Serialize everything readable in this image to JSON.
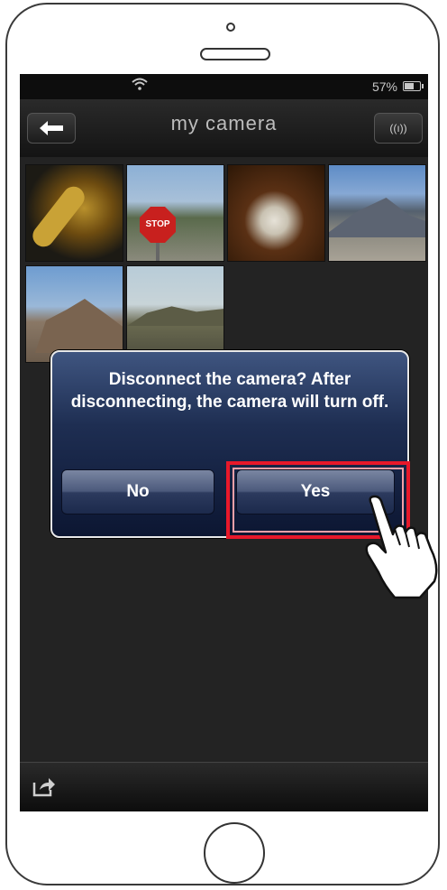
{
  "status_bar": {
    "battery": "57%"
  },
  "nav": {
    "title": "my camera",
    "wireless_icon": "((📶))"
  },
  "photos": [
    "saxophone",
    "stop-sign",
    "record-player",
    "mountain",
    "rock-formation",
    "desert-hills"
  ],
  "dialog": {
    "message": "Disconnect the camera? After disconnecting, the camera will turn off.",
    "no_label": "No",
    "yes_label": "Yes"
  },
  "colors": {
    "highlight": "#e8182a",
    "dialog": "#1e2e52"
  }
}
